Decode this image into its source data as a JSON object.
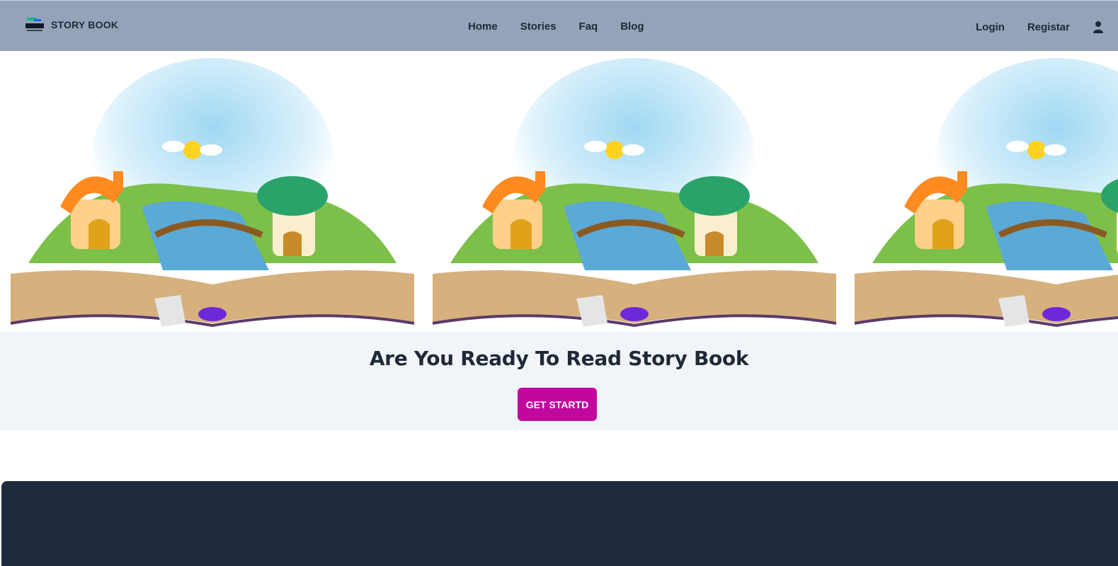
{
  "navbar": {
    "brand_text": "STORY BOOK",
    "links": [
      "Home",
      "Stories",
      "Faq",
      "Blog"
    ],
    "login": "Login",
    "register": "Registar",
    "user_icon": "user-icon"
  },
  "hero": {
    "image": "open-pop-up-storybook-illustration",
    "tile_count": 3
  },
  "cta": {
    "title": "Are You Ready To Read Story Book",
    "button": "GET STARTD"
  },
  "colors": {
    "navbar_bg": "#94a3b8",
    "cta_bg": "#f1f4f8",
    "button_bg": "#c0089c",
    "footer_bg": "#1f2a3c"
  }
}
